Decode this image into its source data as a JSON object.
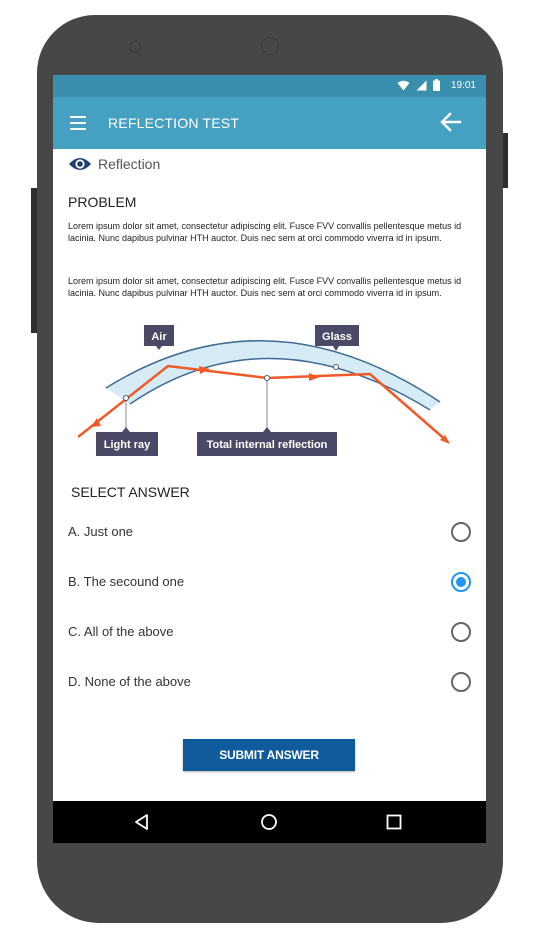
{
  "status_bar": {
    "time": "19:01",
    "icons": [
      "wifi-icon",
      "signal-icon",
      "battery-icon"
    ]
  },
  "app_bar": {
    "title": "REFLECTION TEST",
    "menu_icon": "menu-icon",
    "back_icon": "back-arrow-icon"
  },
  "breadcrumb": {
    "icon": "eye-icon",
    "label": "Reflection"
  },
  "problem": {
    "heading": "PROBLEM",
    "paragraphs": [
      "Lorem ipsum dolor sit amet, consectetur adipiscing elit. Fusce FVV convallis pellentesque metus id lacinia. Nunc dapibus pulvinar HTH auctor. Duis nec sem at orci commodo viverra id in ipsum.",
      "Lorem ipsum dolor sit amet, consectetur adipiscing elit. Fusce FVV convallis pellentesque metus id lacinia. Nunc dapibus pulvinar HTH auctor. Duis nec sem at orci commodo viverra id in ipsum."
    ]
  },
  "diagram": {
    "labels": {
      "air": "Air",
      "glass": "Glass",
      "light_ray": "Light ray",
      "total_internal_reflection": "Total internal reflection"
    },
    "colors": {
      "ray": "#f05a28",
      "glass_fill": "#d6ebf5",
      "glass_edge": "#3f6c93",
      "label_bg": "#4a4a66"
    }
  },
  "answers": {
    "heading": "SELECT ANSWER",
    "options": [
      {
        "label": "A. Just one",
        "selected": false
      },
      {
        "label": "B. The secound one",
        "selected": true
      },
      {
        "label": "C. All of the above",
        "selected": false
      },
      {
        "label": "D. None of the above",
        "selected": false
      }
    ]
  },
  "submit": {
    "label": "SUBMIT ANSWER"
  },
  "nav_bar": {
    "icons": [
      "nav-back-icon",
      "nav-home-icon",
      "nav-recents-icon"
    ]
  },
  "colors": {
    "status_bar": "#3a8fae",
    "app_bar": "#45a1c2",
    "accent": "#2196f3",
    "button": "#0f5b9c",
    "phone_body": "#474747"
  }
}
